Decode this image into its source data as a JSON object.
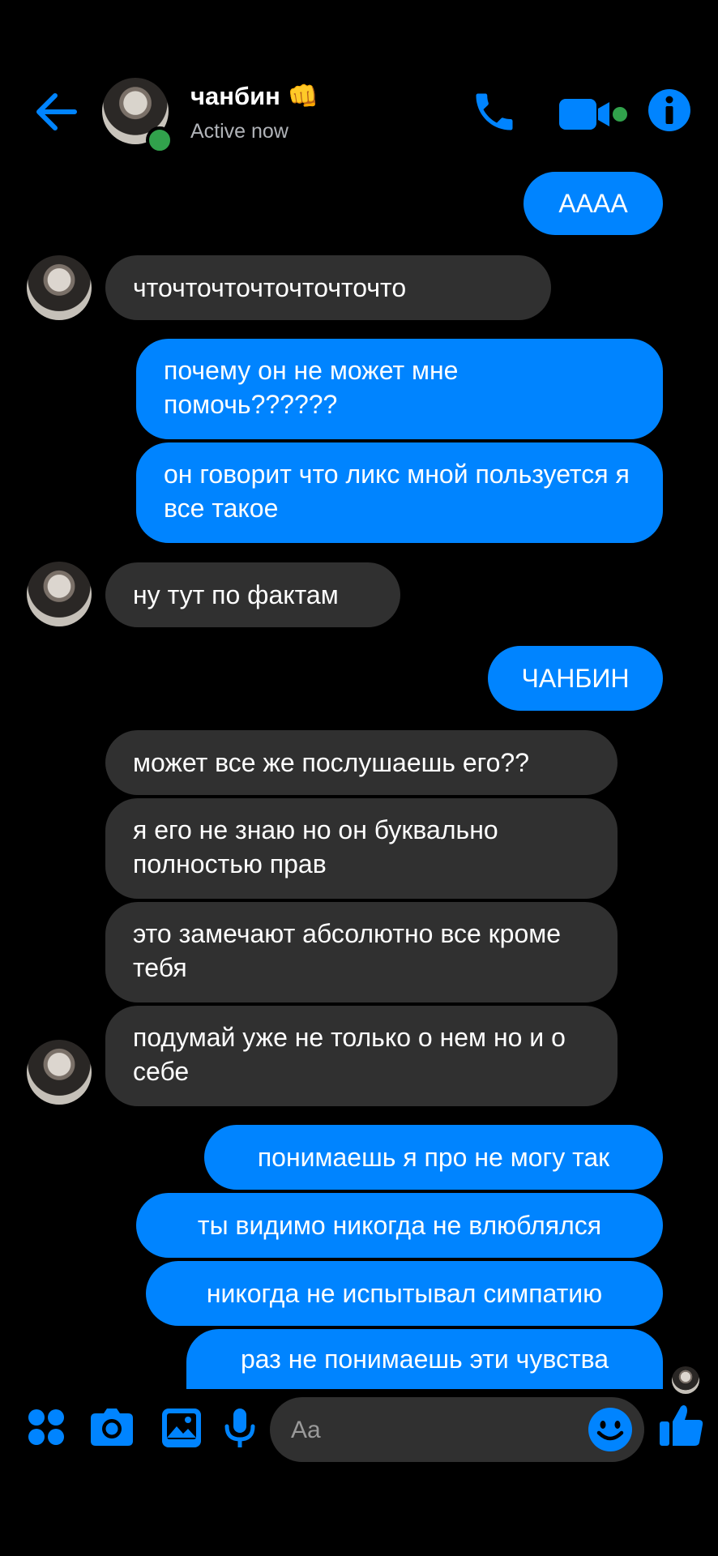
{
  "header": {
    "contact_name": "чанбин",
    "contact_emoji": "👊",
    "status": "Active now",
    "icons": [
      "back-arrow-icon",
      "phone-icon",
      "video-camera-icon",
      "info-icon"
    ],
    "accent_color": "#0084ff"
  },
  "messages": [
    {
      "from": "me",
      "text": "АААА"
    },
    {
      "from": "them",
      "text": "чточточточточточточто"
    },
    {
      "from": "me",
      "text": "почему он не может мне помочь??????"
    },
    {
      "from": "me",
      "text": "он говорит что ликс мной пользуется я все такое"
    },
    {
      "from": "them",
      "text": "ну тут по фактам"
    },
    {
      "from": "me",
      "text": "ЧАНБИН"
    },
    {
      "from": "them",
      "text": "может все же послушаешь его??"
    },
    {
      "from": "them",
      "text": "я его не знаю но он буквально полностью прав"
    },
    {
      "from": "them",
      "text": "это замечают абсолютно все кроме тебя"
    },
    {
      "from": "them",
      "text": "подумай уже не только о нем но и о себе"
    },
    {
      "from": "me",
      "text": "понимаешь я про не могу так"
    },
    {
      "from": "me",
      "text": "ты видимо никогда не влюблялся"
    },
    {
      "from": "me",
      "text": "никогда не испытывал симпатию"
    },
    {
      "from": "me",
      "text": "раз не понимаешь эти чувства"
    }
  ],
  "composer": {
    "placeholder": "Aa",
    "icons": [
      "apps-icon",
      "camera-icon",
      "gallery-icon",
      "microphone-icon",
      "emoji-icon",
      "thumbs-up-icon"
    ]
  }
}
